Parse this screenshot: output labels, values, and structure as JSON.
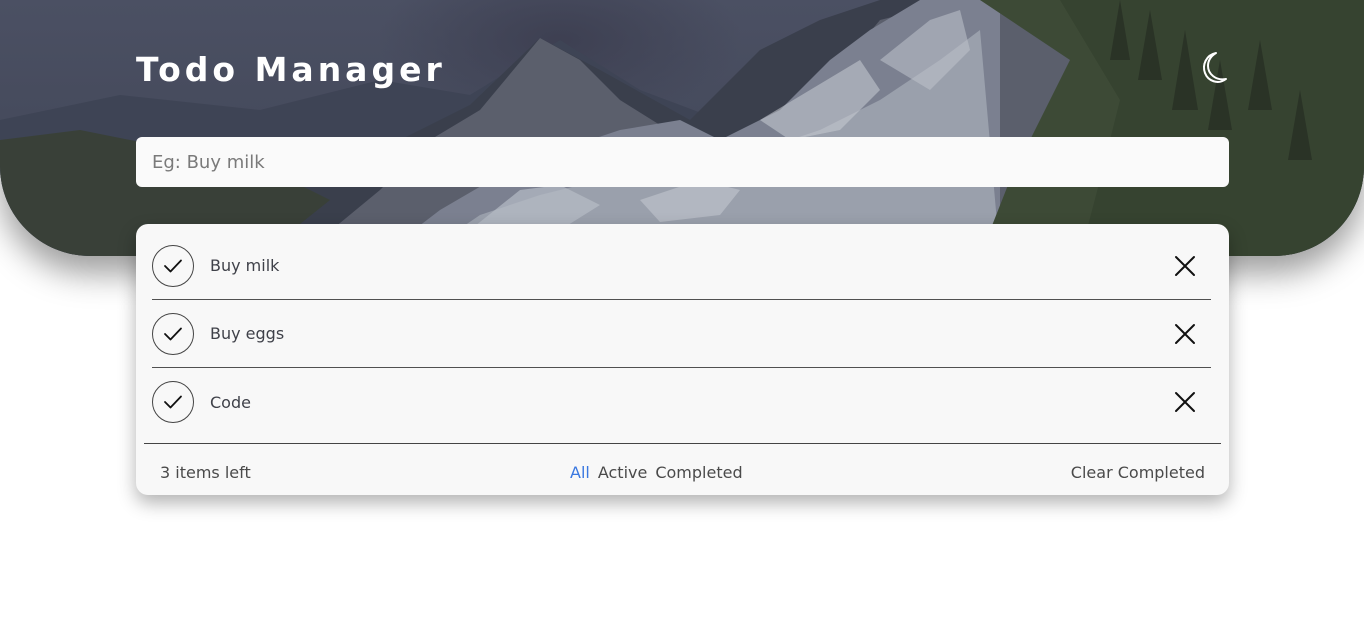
{
  "header": {
    "title": "Todo Manager",
    "theme_toggle_icon": "moon-icon"
  },
  "new_todo": {
    "placeholder": "Eg: Buy milk",
    "value": ""
  },
  "todos": [
    {
      "label": "Buy milk",
      "check_icon": "checkmark-icon",
      "delete_icon": "close-icon"
    },
    {
      "label": "Buy eggs",
      "check_icon": "checkmark-icon",
      "delete_icon": "close-icon"
    },
    {
      "label": "Code",
      "check_icon": "checkmark-icon",
      "delete_icon": "close-icon"
    }
  ],
  "footer": {
    "items_left": "3 items left",
    "filters": [
      "All",
      "Active",
      "Completed"
    ],
    "active_filter": "All",
    "clear_completed": "Clear Completed"
  },
  "colors": {
    "active_filter": "#3a78e0",
    "card_background": "#f8f8f8",
    "input_background": "#fafafa"
  }
}
